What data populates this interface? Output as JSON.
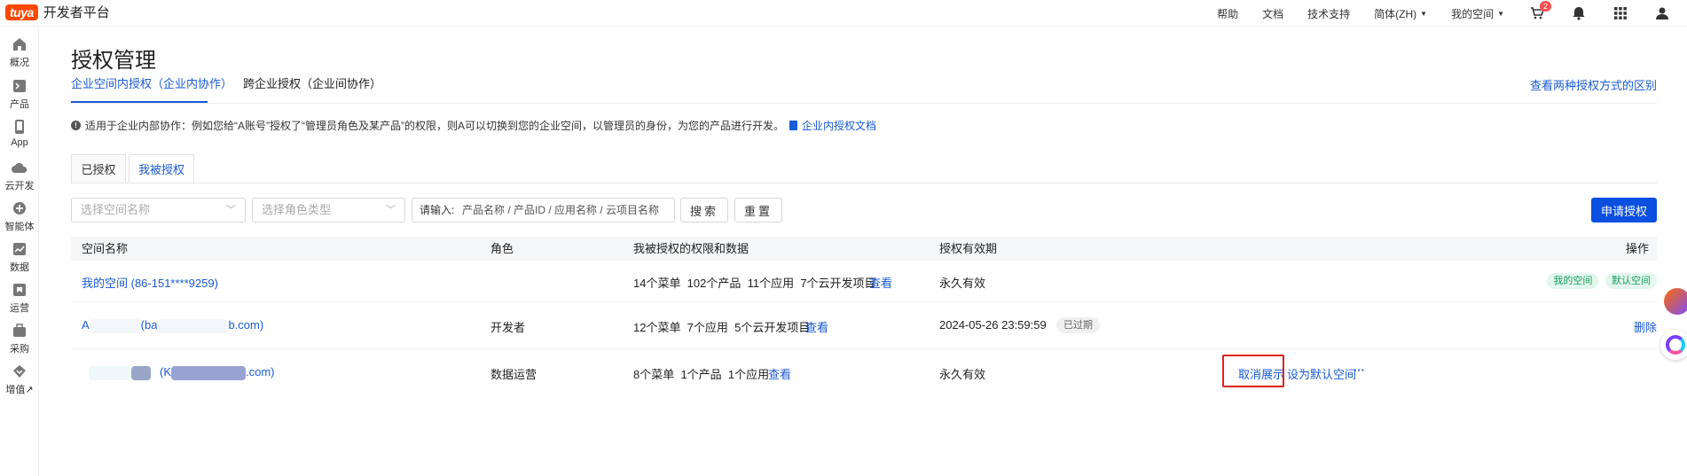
{
  "header": {
    "logo_mark": "tuya",
    "logo_text": "开发者平台",
    "nav": [
      "帮助",
      "文档",
      "技术支持"
    ],
    "language": "简体(ZH)",
    "my_space": "我的空间",
    "cart_count": "2",
    "icons": [
      "cart-icon",
      "bell-icon",
      "apps-grid-icon",
      "user-icon"
    ]
  },
  "sidebar": {
    "items": [
      {
        "label": "概况",
        "icon": "home-icon"
      },
      {
        "label": "产品",
        "icon": "terminal-icon"
      },
      {
        "label": "App",
        "icon": "phone-icon"
      },
      {
        "label": "云开发",
        "icon": "cloud-icon"
      },
      {
        "label": "智能体",
        "icon": "agent-icon"
      },
      {
        "label": "数据",
        "icon": "chart-icon"
      },
      {
        "label": "运营",
        "icon": "operations-icon"
      },
      {
        "label": "采购",
        "icon": "purchase-icon"
      },
      {
        "label": "增值↗",
        "icon": "value-added-icon"
      }
    ]
  },
  "page": {
    "title": "授权管理",
    "tabs": [
      "企业空间内授权（企业内协作）",
      "跨企业授权（企业间协作）"
    ],
    "compare_link": "查看两种授权方式的区别",
    "info_text": "适用于企业内部协作：例如您给“A账号”授权了“管理员角色及某产品”的权限，则A可以切换到您的企业空间，以管理员的身份，为您的产品进行开发。",
    "doc_link": "企业内授权文档",
    "subtabs": [
      "已授权",
      "我被授权"
    ]
  },
  "filters": {
    "space_placeholder": "选择空间名称",
    "role_placeholder": "选择角色类型",
    "search_label": "请输入:",
    "search_placeholder": "产品名称 / 产品ID / 应用名称 / 云项目名称",
    "search_button": "搜索",
    "reset_button": "重置",
    "apply_button": "申请授权"
  },
  "table": {
    "columns": [
      "空间名称",
      "角色",
      "我被授权的权限和数据",
      "授权有效期",
      "操作"
    ],
    "rows": [
      {
        "space_name": "我的空间 (86-151****9259)",
        "role": "",
        "permissions": "14个菜单  102个产品  11个应用  7个云开发项目",
        "view": "查看",
        "validity": "永久有效",
        "tags": [
          "我的空间",
          "默认空间"
        ]
      },
      {
        "space_name_prefix": "A",
        "space_name_mid": "(ba",
        "space_name_suffix": "b.com)",
        "role": "开发者",
        "permissions": "12个菜单  7个应用  5个云开发项目",
        "view": "查看",
        "validity": "2024-05-26 23:59:59",
        "status_badge": "已过期",
        "action": "删除"
      },
      {
        "space_name_mid": "(K",
        "space_name_suffix": ".com)",
        "role": "数据运营",
        "permissions": "8个菜单  1个产品  1个应用",
        "view": "查看",
        "validity": "永久有效",
        "actions": [
          "取消展示",
          "设为默认空间",
          "···"
        ]
      }
    ]
  },
  "colors": {
    "brand": "#ff4800",
    "link": "#1a5bd7",
    "primary_button": "#0a4fe0",
    "highlight_box": "#e02020",
    "tag_green": "#1a9e60"
  }
}
